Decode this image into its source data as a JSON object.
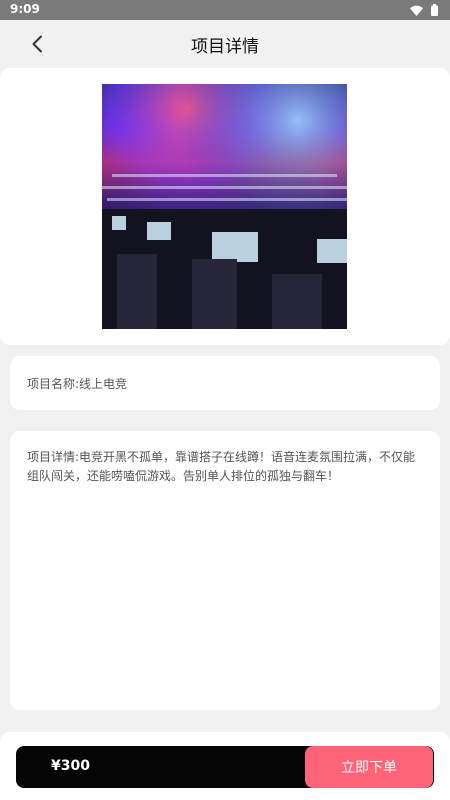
{
  "status_bar": {
    "time": "9:09",
    "icons": [
      "wifi-icon",
      "battery-icon"
    ]
  },
  "header": {
    "title": "项目详情",
    "back_icon": "chevron-left-icon"
  },
  "project": {
    "name": "项目名称:线上电竞",
    "description": "项目详情:电竞开黑不孤单，靠谱搭子在线蹲！语音连麦氛围拉满，不仅能组队闯关，还能唠嗑侃游戏。告别单人排位的孤独与翻车！"
  },
  "checkout": {
    "price": "¥300",
    "order_label": "立即下单"
  },
  "colors": {
    "accent": "#ff6378",
    "checkout_bg": "#050505",
    "page_bg": "#f1f1f1"
  }
}
